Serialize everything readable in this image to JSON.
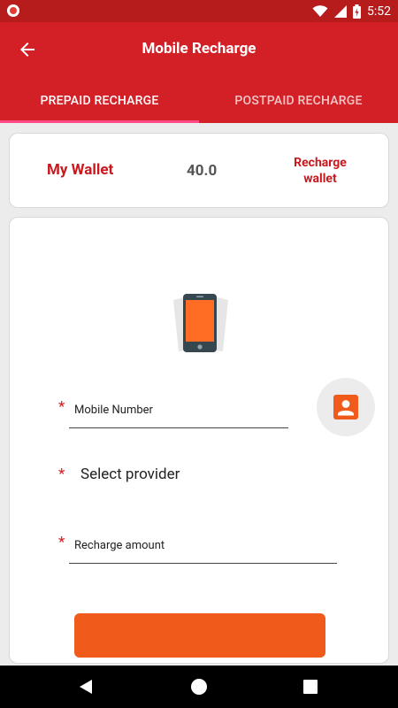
{
  "status_bar": {
    "time": "5:52"
  },
  "app_bar": {
    "title": "Mobile Recharge"
  },
  "tabs": [
    {
      "label": "PREPAID RECHARGE",
      "active": true
    },
    {
      "label": "POSTPAID RECHARGE",
      "active": false
    }
  ],
  "wallet": {
    "label": "My Wallet",
    "amount": "40.0",
    "recharge_line1": "Recharge",
    "recharge_line2": "wallet"
  },
  "form": {
    "required_marker": "*",
    "mobile_number_label": "Mobile Number",
    "provider_label": "Select provider",
    "amount_label": "Recharge amount"
  },
  "colors": {
    "primary": "#d32027",
    "status_bar": "#b71c1c",
    "accent_tab_indicator": "#ff4b8a",
    "contact_icon": "#f05a1a",
    "submit_button": "#f05a1a"
  },
  "icons": [
    "record-icon",
    "wifi-icon",
    "signal-icon",
    "battery-icon",
    "back-arrow-icon",
    "phone-illustration-icon",
    "contact-icon",
    "nav-back-icon",
    "nav-home-icon",
    "nav-recents-icon"
  ]
}
